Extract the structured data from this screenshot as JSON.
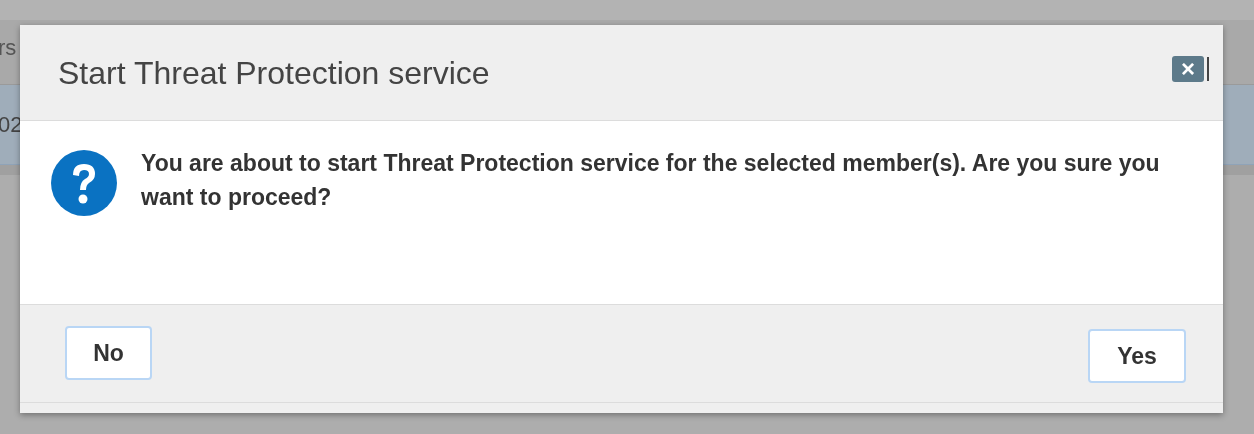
{
  "background": {
    "header_fragment": "rs",
    "row_fragment": "02"
  },
  "dialog": {
    "title": "Start Threat Protection service",
    "close_label": "×",
    "message": "You are about to start Threat Protection service for the selected member(s). Are you sure you want to proceed?",
    "buttons": [
      {
        "label": "No",
        "kind": "left"
      },
      {
        "label": "Yes",
        "kind": "right"
      }
    ]
  }
}
